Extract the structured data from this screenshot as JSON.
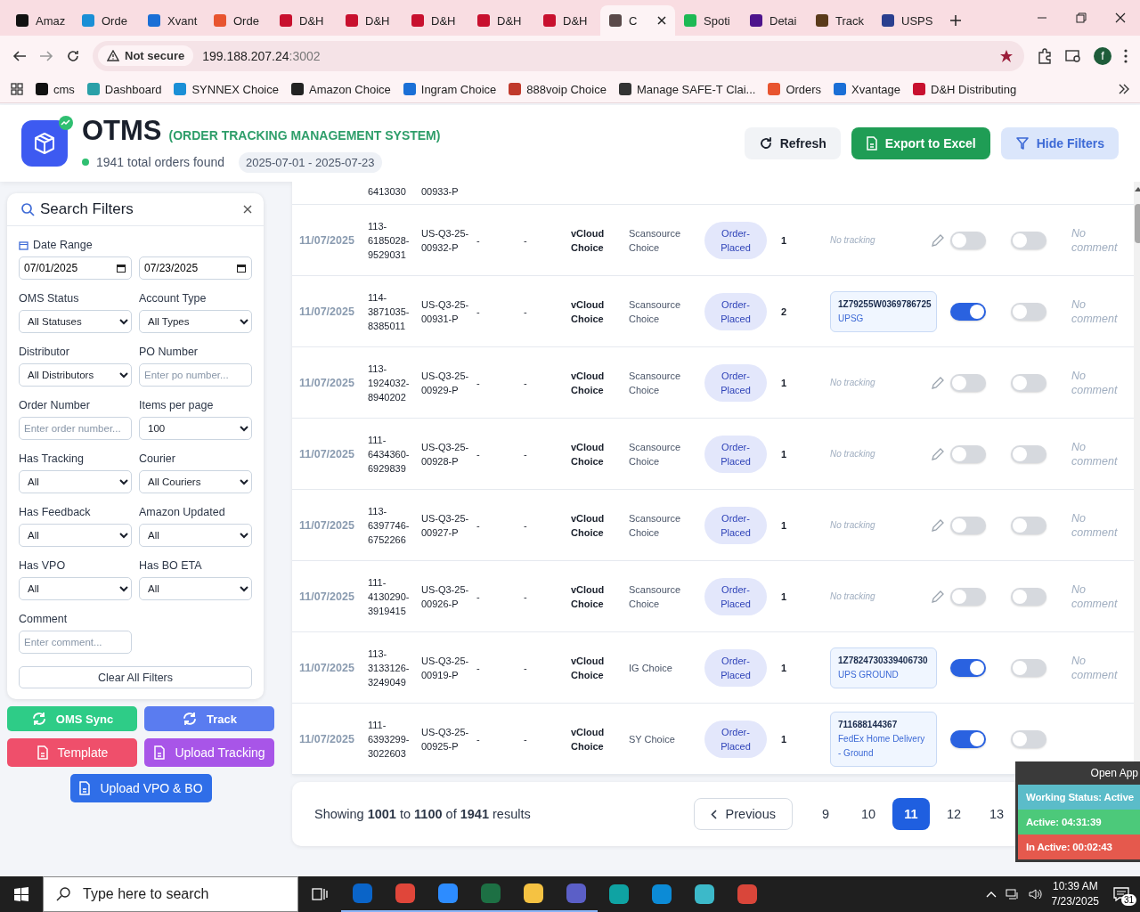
{
  "browser": {
    "tabs": [
      {
        "label": "Amaz",
        "color": "#111111",
        "selected": false
      },
      {
        "label": "Orde",
        "color": "#1a8fd6",
        "selected": false
      },
      {
        "label": "Xvant",
        "color": "#1a6fd6",
        "selected": false
      },
      {
        "label": "Orde",
        "color": "#e8542f",
        "selected": false
      },
      {
        "label": "D&H",
        "color": "#c8102e",
        "selected": false
      },
      {
        "label": "D&H",
        "color": "#c8102e",
        "selected": false
      },
      {
        "label": "D&H",
        "color": "#c8102e",
        "selected": false
      },
      {
        "label": "D&H",
        "color": "#c8102e",
        "selected": false
      },
      {
        "label": "D&H",
        "color": "#c8102e",
        "selected": false
      },
      {
        "label": "C",
        "color": "#5a4a4a",
        "selected": true
      },
      {
        "label": "Spoti",
        "color": "#1db954",
        "selected": false
      },
      {
        "label": "Detai",
        "color": "#4d148c",
        "selected": false
      },
      {
        "label": "Track",
        "color": "#5a3a1a",
        "selected": false
      },
      {
        "label": "USPS",
        "color": "#2a3f8f",
        "selected": false
      }
    ],
    "address": {
      "security": "Not secure",
      "host": "199.188.207.24",
      "port": ":3002"
    },
    "profile": "f",
    "bookmarks": [
      {
        "label": "cms",
        "color": "#111111"
      },
      {
        "label": "Dashboard",
        "color": "#2aa0a8"
      },
      {
        "label": "SYNNEX Choice",
        "color": "#1a8fd6"
      },
      {
        "label": "Amazon Choice",
        "color": "#222222"
      },
      {
        "label": "Ingram Choice",
        "color": "#1a6fd6"
      },
      {
        "label": "888voip Choice",
        "color": "#c0392b"
      },
      {
        "label": "Manage SAFE-T Clai...",
        "color": "#333333"
      },
      {
        "label": "Orders",
        "color": "#e8542f"
      },
      {
        "label": "Xvantage",
        "color": "#1a6fd6"
      },
      {
        "label": "D&H Distributing",
        "color": "#c8102e"
      }
    ]
  },
  "header": {
    "title": "OTMS",
    "subtitle": "(ORDER TRACKING MANAGEMENT SYSTEM)",
    "summary": "1941 total orders found",
    "date_chip": "2025-07-01 - 2025-07-23",
    "buttons": [
      {
        "label": "Refresh",
        "kind": "refresh"
      },
      {
        "label": "Export to Excel",
        "kind": "export"
      },
      {
        "label": "Hide Filters",
        "kind": "filter"
      }
    ]
  },
  "filters": {
    "title": "Search Filters",
    "date_range": {
      "label": "Date Range",
      "from": "07/01/2025",
      "to": "07/23/2025"
    },
    "fields": [
      {
        "label": "OMS Status",
        "kind": "select",
        "value": "All Statuses"
      },
      {
        "label": "Account Type",
        "kind": "select",
        "value": "All Types"
      },
      {
        "label": "Distributor",
        "kind": "select",
        "value": "All Distributors"
      },
      {
        "label": "PO Number",
        "kind": "text",
        "placeholder": "Enter po number..."
      },
      {
        "label": "Order Number",
        "kind": "text",
        "placeholder": "Enter order number..."
      },
      {
        "label": "Items per page",
        "kind": "select",
        "value": "100"
      },
      {
        "label": "Has Tracking",
        "kind": "select",
        "value": "All"
      },
      {
        "label": "Courier",
        "kind": "select",
        "value": "All Couriers"
      },
      {
        "label": "Has Feedback",
        "kind": "select",
        "value": "All"
      },
      {
        "label": "Amazon Updated",
        "kind": "select",
        "value": "All"
      },
      {
        "label": "Has VPO",
        "kind": "select",
        "value": "All"
      },
      {
        "label": "Has BO ETA",
        "kind": "select",
        "value": "All"
      },
      {
        "label": "Comment",
        "kind": "text",
        "placeholder": "Enter comment..."
      }
    ],
    "clear_button": "Clear All Filters"
  },
  "actions": [
    {
      "label": "OMS Sync",
      "kind": "sync",
      "color": "#2ecc87"
    },
    {
      "label": "Track",
      "kind": "sync",
      "color": "#5a7cf0"
    },
    {
      "label": "Template",
      "kind": "file",
      "color": "#ef4f6b"
    },
    {
      "label": "Upload Tracking",
      "kind": "file",
      "color": "#a855e8"
    },
    {
      "label": "Upload VPO & BO",
      "kind": "file",
      "color": "#2f6ee8"
    }
  ],
  "table": {
    "partial_row": {
      "order_id": "6413030",
      "ref": "00933-P"
    },
    "rows": [
      {
        "date": "11/07/2025",
        "order_id": "113-6185028-9529031",
        "ref": "US-Q3-25-00932-P",
        "col_4": "-",
        "col_5": "-",
        "account": "vCloud Choice",
        "source": "Scansource Choice",
        "status": "Order-Placed",
        "qty": "1",
        "tracking_note": "No tracking",
        "toggle_1": false,
        "toggle_2": false,
        "comment": "No comment"
      },
      {
        "date": "11/07/2025",
        "order_id": "114-3871035-8385011",
        "ref": "US-Q3-25-00931-P",
        "col_4": "-",
        "col_5": "-",
        "account": "vCloud Choice",
        "source": "Scansource Choice",
        "status": "Order-Placed",
        "qty": "2",
        "tracking": {
          "number": "1Z79255W0369786725",
          "carrier": "UPSG"
        },
        "toggle_1": true,
        "toggle_2": false,
        "comment": "No comment"
      },
      {
        "date": "11/07/2025",
        "order_id": "113-1924032-8940202",
        "ref": "US-Q3-25-00929-P",
        "col_4": "-",
        "col_5": "-",
        "account": "vCloud Choice",
        "source": "Scansource Choice",
        "status": "Order-Placed",
        "qty": "1",
        "tracking_note": "No tracking",
        "toggle_1": false,
        "toggle_2": false,
        "comment": "No comment"
      },
      {
        "date": "11/07/2025",
        "order_id": "111-6434360-6929839",
        "ref": "US-Q3-25-00928-P",
        "col_4": "-",
        "col_5": "-",
        "account": "vCloud Choice",
        "source": "Scansource Choice",
        "status": "Order-Placed",
        "qty": "1",
        "tracking_note": "No tracking",
        "toggle_1": false,
        "toggle_2": false,
        "comment": "No comment"
      },
      {
        "date": "11/07/2025",
        "order_id": "113-6397746-6752266",
        "ref": "US-Q3-25-00927-P",
        "col_4": "-",
        "col_5": "-",
        "account": "vCloud Choice",
        "source": "Scansource Choice",
        "status": "Order-Placed",
        "qty": "1",
        "tracking_note": "No tracking",
        "toggle_1": false,
        "toggle_2": false,
        "comment": "No comment"
      },
      {
        "date": "11/07/2025",
        "order_id": "111-4130290-3919415",
        "ref": "US-Q3-25-00926-P",
        "col_4": "-",
        "col_5": "-",
        "account": "vCloud Choice",
        "source": "Scansource Choice",
        "status": "Order-Placed",
        "qty": "1",
        "tracking_note": "No tracking",
        "toggle_1": false,
        "toggle_2": false,
        "comment": "No comment"
      },
      {
        "date": "11/07/2025",
        "order_id": "113-3133126-3249049",
        "ref": "US-Q3-25-00919-P",
        "col_4": "-",
        "col_5": "-",
        "account": "vCloud Choice",
        "source": "IG Choice",
        "status": "Order-Placed",
        "qty": "1",
        "tracking": {
          "number": "1Z7824730339406730",
          "carrier": "UPS GROUND"
        },
        "toggle_1": true,
        "toggle_2": false,
        "comment": "No comment"
      },
      {
        "date": "11/07/2025",
        "order_id": "111-6393299-3022603",
        "ref": "US-Q3-25-00925-P",
        "col_4": "-",
        "col_5": "-",
        "account": "vCloud Choice",
        "source": "SY Choice",
        "status": "Order-Placed",
        "qty": "1",
        "tracking": {
          "number": "711688144367",
          "carrier": "FedEx Home Delivery - Ground"
        },
        "toggle_1": true,
        "toggle_2": false
      }
    ]
  },
  "pagination": {
    "summary": "Showing **1001** to **1100** of **1941** results",
    "previous": "Previous",
    "pages": [
      {
        "label": "9",
        "selected": false
      },
      {
        "label": "10",
        "selected": false
      },
      {
        "label": "11",
        "selected": true
      },
      {
        "label": "12",
        "selected": false
      },
      {
        "label": "13",
        "selected": false
      }
    ]
  },
  "status_widget": {
    "open_app": "Open App",
    "lines": [
      {
        "text": "Working Status: Active",
        "color": "#5bbcc9"
      },
      {
        "text": "Active: 04:31:39",
        "color": "#4cc97a"
      },
      {
        "text": "In Active: 00:02:43",
        "color": "#e5594d"
      }
    ]
  },
  "taskbar": {
    "search_placeholder": "Type here to search",
    "apps": [
      {
        "color": "#0a64c8",
        "running": true
      },
      {
        "color": "#e0463a",
        "running": true
      },
      {
        "color": "#2d8cff",
        "running": true
      },
      {
        "color": "#1d7044",
        "running": true
      },
      {
        "color": "#f5c242",
        "running": true
      },
      {
        "color": "#5b5fc7",
        "running": true
      },
      {
        "color": "#0fa3a3",
        "running": false
      },
      {
        "color": "#0c8bd6",
        "running": false
      },
      {
        "color": "#3cb9c9",
        "running": false
      },
      {
        "color": "#d9463a",
        "running": false
      }
    ],
    "time": "10:39 AM",
    "date": "7/23/2025",
    "notifications": "31"
  }
}
